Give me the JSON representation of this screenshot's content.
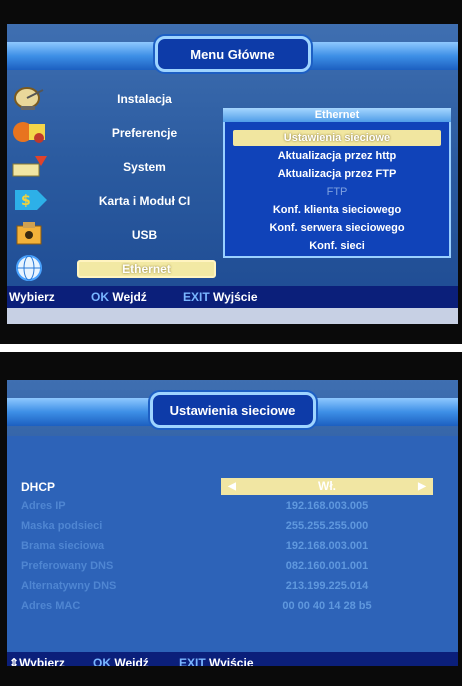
{
  "main_menu": {
    "title": "Menu Główne",
    "items": [
      "Instalacja",
      "Preferencje",
      "System",
      "Karta i Moduł CI",
      "USB",
      "Ethernet"
    ],
    "active_item": "Ethernet",
    "icons": [
      "satellite-dish-icon",
      "preferences-icon",
      "system-icon",
      "card-module-icon",
      "usb-icon",
      "ethernet-globe-icon"
    ],
    "submenu": {
      "title": "Ethernet",
      "items": [
        {
          "label": "Ustawienia sieciowe",
          "state": "selected"
        },
        {
          "label": "Aktualizacja przez http",
          "state": "normal"
        },
        {
          "label": "Aktualizacja przez FTP",
          "state": "normal"
        },
        {
          "label": "FTP",
          "state": "disabled"
        },
        {
          "label": "Konf. klienta sieciowego",
          "state": "normal"
        },
        {
          "label": "Konf. serwera sieciowego",
          "state": "normal"
        },
        {
          "label": "Konf. sieci",
          "state": "normal"
        }
      ]
    },
    "bottom_bar": {
      "select": "Wybierz",
      "ok_key": "OK",
      "ok_label": "Wejdź",
      "exit_key": "EXIT",
      "exit_label": "Wyjście"
    }
  },
  "network_settings": {
    "title": "Ustawienia sieciowe",
    "dhcp": {
      "label": "DHCP",
      "value": "Wł."
    },
    "fields": [
      {
        "label": "Adres IP",
        "value": "192.168.003.005"
      },
      {
        "label": "Maska podsieci",
        "value": "255.255.255.000"
      },
      {
        "label": "Brama sieciowa",
        "value": "192.168.003.001"
      },
      {
        "label": "Preferowany DNS",
        "value": "082.160.001.001"
      },
      {
        "label": "Alternatywny DNS",
        "value": "213.199.225.014"
      },
      {
        "label": "Adres MAC",
        "value": "00 00 40 14 28 b5"
      }
    ],
    "bottom_bar": {
      "select": "Wybierz",
      "ok_key": "OK",
      "ok_label": "Wejdź",
      "exit_key": "EXIT",
      "exit_label": "Wyjście"
    }
  },
  "colors": {
    "screen_blue": "#2b5ba0",
    "highlight": "#f1e6a3",
    "bar_blue": "#0b1f7a",
    "key_blue": "#79b6ff"
  }
}
